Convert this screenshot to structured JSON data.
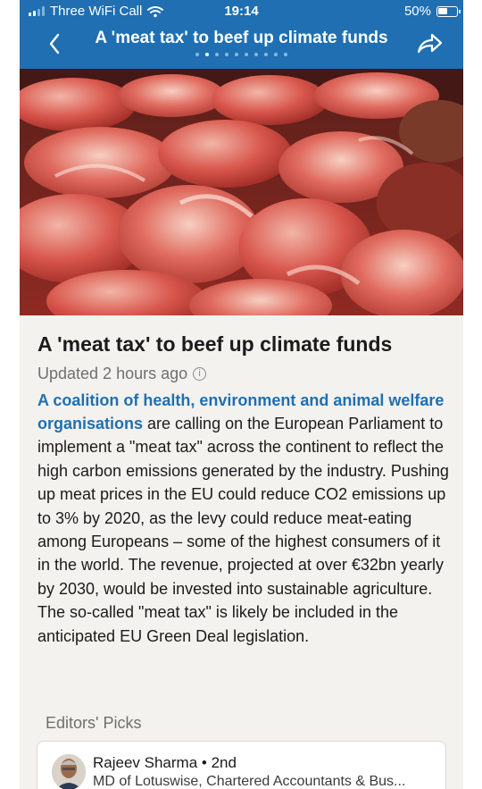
{
  "status_bar": {
    "carrier": "Three WiFi Call",
    "time": "19:14",
    "battery": "50%"
  },
  "nav": {
    "title": "A 'meat tax' to beef up climate funds",
    "page_dots": 10,
    "active_dot": 1
  },
  "article": {
    "headline": "A 'meat tax' to beef up climate funds",
    "updated": "Updated 2 hours ago",
    "lead_link": "A coalition of health, environment and animal welfare organisations",
    "body": " are calling on the European Parliament to implement a \"meat tax\" across the continent to reflect the high carbon emissions generated by the industry. Pushing up meat prices in the EU could reduce CO2 emissions up to 3% by 2020, as the levy could reduce meat-eating among Europeans – some of the highest consumers of it in the world. The revenue, projected at over €32bn yearly by 2030, would be invested into sustainable agriculture. The so-called \"meat tax\" is likely be included in the anticipated EU Green Deal legislation."
  },
  "editors_picks": {
    "heading": "Editors' Picks",
    "post": {
      "author": "Rajeev Sharma",
      "degree": "• 2nd",
      "role": "MD of Lotuswise, Chartered Accountants & Bus..."
    }
  },
  "icons": {
    "back": "chevron-left-icon",
    "share": "share-arrow-icon",
    "info": "info-icon",
    "wifi": "wifi-icon",
    "signal": "signal-bars-icon",
    "battery": "battery-icon"
  },
  "colors": {
    "header": "#1f6fb2",
    "link": "#1f6fb2",
    "background": "#f3f2ef"
  }
}
